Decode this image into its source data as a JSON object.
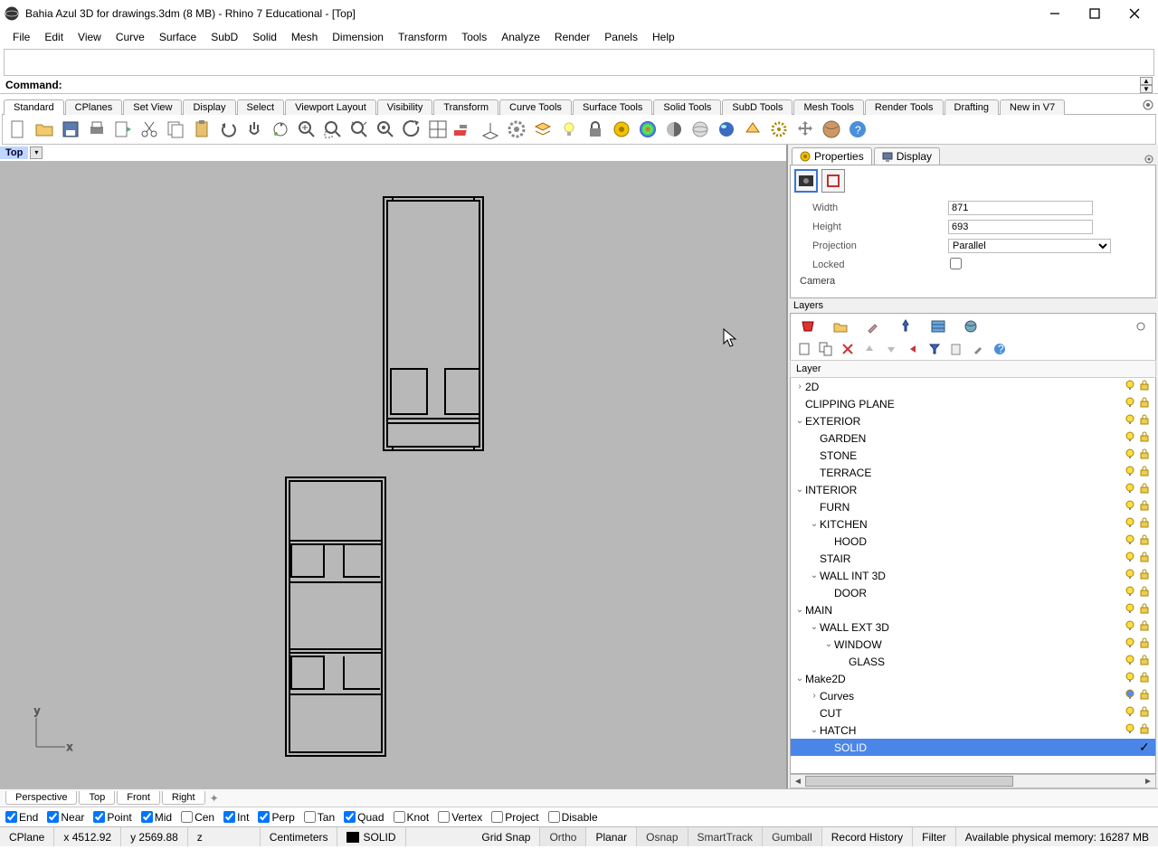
{
  "title": "Bahia Azul 3D for drawings.3dm (8 MB) - Rhino 7 Educational - [Top]",
  "menus": [
    "File",
    "Edit",
    "View",
    "Curve",
    "Surface",
    "SubD",
    "Solid",
    "Mesh",
    "Dimension",
    "Transform",
    "Tools",
    "Analyze",
    "Render",
    "Panels",
    "Help"
  ],
  "command_label": "Command:",
  "command_value": "",
  "toolbar_tabs": [
    "Standard",
    "CPlanes",
    "Set View",
    "Display",
    "Select",
    "Viewport Layout",
    "Visibility",
    "Transform",
    "Curve Tools",
    "Surface Tools",
    "Solid Tools",
    "SubD Tools",
    "Mesh Tools",
    "Render Tools",
    "Drafting",
    "New in V7"
  ],
  "viewport_label": "Top",
  "panel_tabs": {
    "properties": "Properties",
    "display": "Display"
  },
  "props": {
    "width_l": "Width",
    "width_v": "871",
    "height_l": "Height",
    "height_v": "693",
    "proj_l": "Projection",
    "proj_v": "Parallel",
    "locked_l": "Locked",
    "camera": "Camera"
  },
  "layers_title": "Layers",
  "layer_col": "Layer",
  "layers": [
    {
      "depth": 0,
      "exp": "›",
      "name": "2D",
      "bulb": "y",
      "lock": "o"
    },
    {
      "depth": 0,
      "exp": "",
      "name": "CLIPPING PLANE",
      "bulb": "y",
      "lock": "o"
    },
    {
      "depth": 0,
      "exp": "⌄",
      "name": "EXTERIOR",
      "bulb": "y",
      "lock": "o"
    },
    {
      "depth": 1,
      "exp": "",
      "name": "GARDEN",
      "bulb": "y",
      "lock": "o"
    },
    {
      "depth": 1,
      "exp": "",
      "name": "STONE",
      "bulb": "y",
      "lock": "o"
    },
    {
      "depth": 1,
      "exp": "",
      "name": "TERRACE",
      "bulb": "y",
      "lock": "o"
    },
    {
      "depth": 0,
      "exp": "⌄",
      "name": "INTERIOR",
      "bulb": "y",
      "lock": "o"
    },
    {
      "depth": 1,
      "exp": "",
      "name": "FURN",
      "bulb": "y",
      "lock": "o"
    },
    {
      "depth": 1,
      "exp": "⌄",
      "name": "KITCHEN",
      "bulb": "y",
      "lock": "o"
    },
    {
      "depth": 2,
      "exp": "",
      "name": "HOOD",
      "bulb": "y",
      "lock": "o"
    },
    {
      "depth": 1,
      "exp": "",
      "name": "STAIR",
      "bulb": "y",
      "lock": "o"
    },
    {
      "depth": 1,
      "exp": "⌄",
      "name": "WALL INT 3D",
      "bulb": "y",
      "lock": "o"
    },
    {
      "depth": 2,
      "exp": "",
      "name": "DOOR",
      "bulb": "y",
      "lock": "o"
    },
    {
      "depth": 0,
      "exp": "⌄",
      "name": "MAIN",
      "bulb": "y",
      "lock": "o"
    },
    {
      "depth": 1,
      "exp": "⌄",
      "name": "WALL EXT 3D",
      "bulb": "y",
      "lock": "o"
    },
    {
      "depth": 2,
      "exp": "⌄",
      "name": "WINDOW",
      "bulb": "y",
      "lock": "o"
    },
    {
      "depth": 3,
      "exp": "",
      "name": "GLASS",
      "bulb": "y",
      "lock": "o"
    },
    {
      "depth": 0,
      "exp": "⌄",
      "name": "Make2D",
      "bulb": "y",
      "lock": "o"
    },
    {
      "depth": 1,
      "exp": "›",
      "name": "Curves",
      "bulb": "b",
      "lock": "o"
    },
    {
      "depth": 1,
      "exp": "",
      "name": "CUT",
      "bulb": "y",
      "lock": "o"
    },
    {
      "depth": 1,
      "exp": "⌄",
      "name": "HATCH",
      "bulb": "y",
      "lock": "o"
    },
    {
      "depth": 2,
      "exp": "",
      "name": "SOLID",
      "sel": true,
      "chk": true
    }
  ],
  "vtabs": [
    "Perspective",
    "Top",
    "Front",
    "Right"
  ],
  "osnap": [
    {
      "l": "End",
      "c": true
    },
    {
      "l": "Near",
      "c": true
    },
    {
      "l": "Point",
      "c": true
    },
    {
      "l": "Mid",
      "c": true
    },
    {
      "l": "Cen",
      "c": false
    },
    {
      "l": "Int",
      "c": true
    },
    {
      "l": "Perp",
      "c": true
    },
    {
      "l": "Tan",
      "c": false
    },
    {
      "l": "Quad",
      "c": true
    },
    {
      "l": "Knot",
      "c": false
    },
    {
      "l": "Vertex",
      "c": false
    },
    {
      "l": "Project",
      "c": false
    },
    {
      "l": "Disable",
      "c": false
    }
  ],
  "status": {
    "cplane": "CPlane",
    "x": "x 4512.92",
    "y": "y 2569.88",
    "z": "z",
    "units": "Centimeters",
    "layer": "SOLID",
    "gridsnap": "Grid Snap",
    "ortho": "Ortho",
    "planar": "Planar",
    "osnap": "Osnap",
    "smart": "SmartTrack",
    "gumball": "Gumball",
    "record": "Record History",
    "filter": "Filter",
    "mem": "Available physical memory: 16287 MB"
  }
}
